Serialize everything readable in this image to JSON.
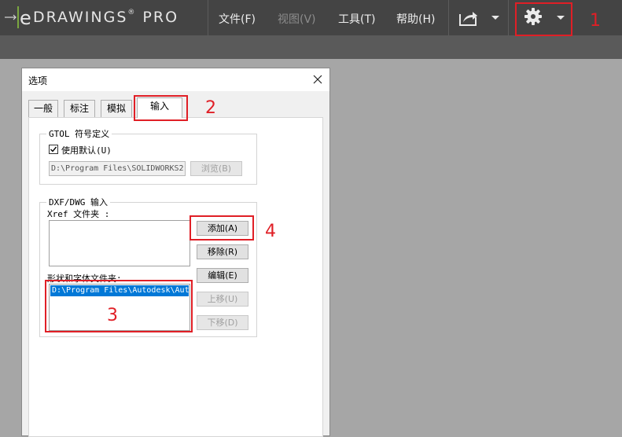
{
  "app": {
    "logo_text": "DRAWINGS",
    "logo_suffix": "PRO",
    "logo_mark": "e",
    "registered": "®"
  },
  "menu": {
    "file": "文件(F)",
    "view": "视图(V)",
    "tools": "工具(T)",
    "help": "帮助(H)"
  },
  "toolbar": {
    "share_icon": "share-icon",
    "settings_icon": "gear-icon"
  },
  "dialog": {
    "title": "选项",
    "tabs": [
      {
        "label": "一般"
      },
      {
        "label": "标注"
      },
      {
        "label": "模拟"
      },
      {
        "label": "输入"
      }
    ],
    "active_tab": "输入",
    "gtol": {
      "title": "GTOL 符号定义",
      "use_default_label": "使用默认(U)",
      "use_default_checked": true,
      "path": "D:\\Program Files\\SOLIDWORKS2",
      "browse_label": "浏览(B)"
    },
    "dxf": {
      "title": "DXF/DWG 输入",
      "xref_label": "Xref 文件夹 :",
      "xref_items": [],
      "shape_font_label": "形状和字体文件夹:",
      "shape_font_items": [
        "D:\\Program Files\\Autodesk\\Aut"
      ],
      "add_label": "添加(A)",
      "remove_label": "移除(R)",
      "edit_label": "编辑(E)",
      "up_label": "上移(U)",
      "down_label": "下移(D)"
    }
  },
  "annotations": {
    "n1": "1",
    "n2": "2",
    "n3": "3",
    "n4": "4",
    "color": "#e01f26"
  },
  "colors": {
    "topbar": "#444444",
    "subbar": "#5a5a5a",
    "workspace": "#a6a6a6",
    "accent_green": "#8dc63f",
    "selection": "#0078d7"
  }
}
